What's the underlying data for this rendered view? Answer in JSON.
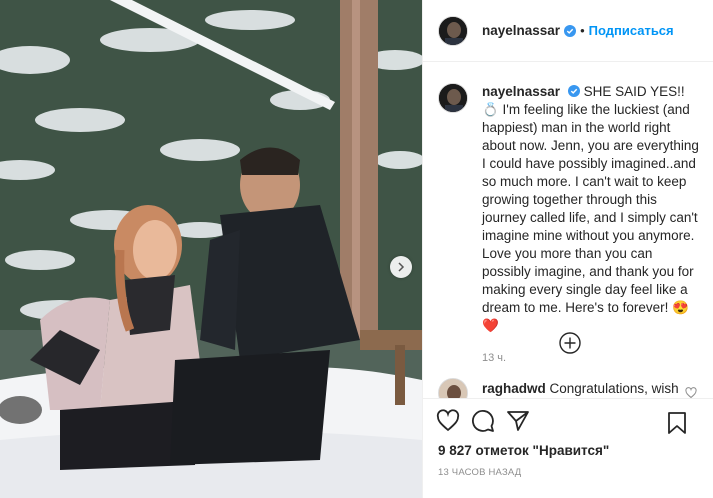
{
  "post": {
    "username": "nayelnassar",
    "follow_label": "Подписаться",
    "dot": "•",
    "caption": "SHE SAID YES!! 💍 I'm feeling like the luckiest (and happiest) man in the world right about now. Jenn, you are everything I could have possibly imagined..and so much more. I can't wait to keep growing together through this journey called life, and I simply can't imagine mine without you anymore. Love you more than you can possibly imagine, and thank you for making every single day feel like a dream to me. Here's to forever! 😍❤️",
    "caption_time": "13 ч.",
    "comment": {
      "username": "raghadwd",
      "text": "Congratulations, wish"
    },
    "likes": "9 827 отметок \"Нравится\"",
    "time": "13 ЧАСОВ НАЗАД"
  },
  "colors": {
    "accent": "#0095f6",
    "verified": "#3897f0",
    "text": "#262626",
    "muted": "#8e8e8e"
  },
  "icons": [
    "verified-badge-icon",
    "like-icon",
    "comment-icon",
    "share-icon",
    "bookmark-icon",
    "load-more-icon",
    "next-arrow-icon",
    "small-heart-icon"
  ]
}
